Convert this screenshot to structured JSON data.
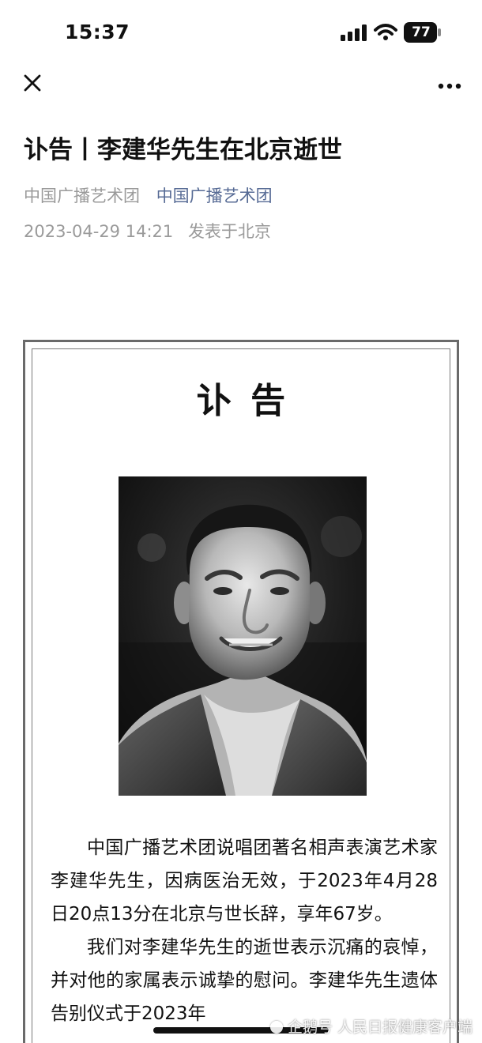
{
  "status_bar": {
    "time": "15:37",
    "battery_level": "77",
    "signal_icon": "signal-icon",
    "wifi_icon": "wifi-icon",
    "battery_icon": "battery-icon"
  },
  "nav": {
    "close_icon": "close-icon",
    "more_icon": "more-icon"
  },
  "article": {
    "title": "讣告丨李建华先生在北京逝世",
    "author": "中国广播艺术团",
    "account": "中国广播艺术团",
    "datetime": "2023-04-29 14:21",
    "location": "发表于北京"
  },
  "obituary": {
    "heading": "讣告",
    "photo_icon": "portrait-photo",
    "paragraphs": [
      "中国广播艺术团说唱团著名相声表演艺术家李建华先生，因病医治无效，于2023年4月28日20点13分在北京与世长辞，享年67岁。",
      "我们对李建华先生的逝世表示沉痛的哀悼，并对他的家属表示诚挚的慰问。李建华先生遗体告别仪式于2023年"
    ]
  },
  "watermark": {
    "text": "企鹅号 人民日报健康客户端"
  },
  "colors": {
    "account_link": "#576b95",
    "meta_gray": "#9a9a9a",
    "frame_gray": "#6a6a6a"
  }
}
